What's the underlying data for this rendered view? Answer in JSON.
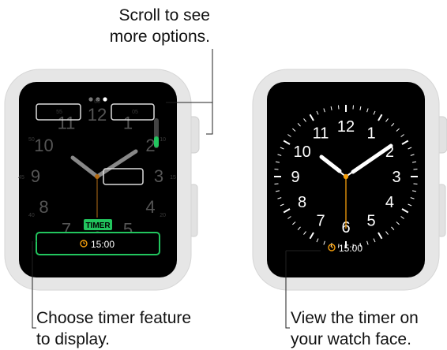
{
  "callouts": {
    "top": [
      "Scroll to see",
      "more options."
    ],
    "left": [
      "Choose timer feature",
      "to display."
    ],
    "right": [
      "View the timer on",
      "your watch face."
    ]
  },
  "left_watch": {
    "page_dots": 3,
    "active_page_dot": 2,
    "numerals": [
      "12",
      "1",
      "2",
      "3",
      "4",
      "5",
      "6",
      "7",
      "8",
      "9",
      "10",
      "11"
    ],
    "selected_label": "TIMER",
    "selected_value": "15:00",
    "dial_ticks": [
      "60",
      "05",
      "10",
      "15",
      "20",
      "25",
      "30",
      "35",
      "40",
      "45",
      "50",
      "55"
    ]
  },
  "right_watch": {
    "numerals": [
      "12",
      "1",
      "2",
      "3",
      "4",
      "5",
      "6",
      "7",
      "8",
      "9",
      "10",
      "11"
    ],
    "timer_value": "15:00"
  },
  "colors": {
    "accent_green": "#22c55e",
    "accent_orange": "#f59e0b",
    "bezel": "#e6e6e6",
    "screen": "#000000"
  }
}
